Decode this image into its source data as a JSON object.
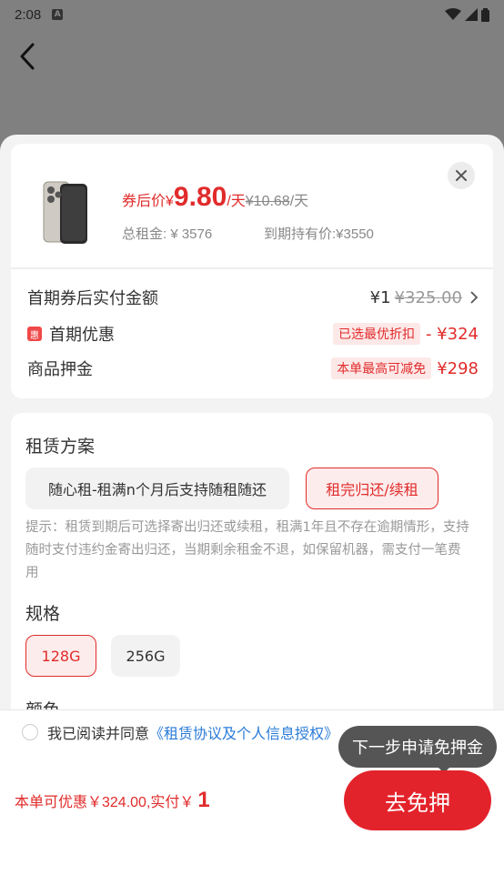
{
  "status_bar": {
    "time": "2:08"
  },
  "product": {
    "price_prefix": "券后价",
    "currency": "¥",
    "price": "9.80",
    "per_day": "/天",
    "original_price": "¥10.68",
    "original_per_day": "/天",
    "total_rent": "总租金: ¥ 3576",
    "buyout_price": "到期持有价:¥3550"
  },
  "summary_rows": [
    {
      "label": "首期券后实付金额",
      "value": "¥1",
      "strike": "¥325.00"
    },
    {
      "label": "首期优惠",
      "badge": "惠",
      "tag": "已选最优折扣",
      "value": "- ¥324"
    },
    {
      "label": "商品押金",
      "tag": "本单最高可减免",
      "value": "¥298"
    }
  ],
  "plan": {
    "title": "租赁方案",
    "options": [
      "随心租-租满n个月后支持随租随还",
      "租完归还/续租"
    ],
    "selected_index": 1,
    "hint": "提示：租赁到期后可选择寄出归还或续租，租满1年且不存在逾期情形，支持随时支付违约金寄出归还，当期剩余租金不退，如保留机器，需支付一笔费用"
  },
  "spec": {
    "title": "规格",
    "options": [
      "128G",
      "256G"
    ],
    "selected_index": 0
  },
  "color_section": {
    "title": "颜色"
  },
  "agreement": {
    "text": "我已阅读并同意",
    "link": "《租赁协议及个人信息授权》"
  },
  "tooltip": "下一步申请免押金",
  "footer": {
    "summary": "本单可优惠￥324.00,实付￥",
    "amount": "1",
    "cta_label": "去免押"
  },
  "colors": {
    "accent": "#e3232b",
    "link": "#2a7bd8"
  }
}
